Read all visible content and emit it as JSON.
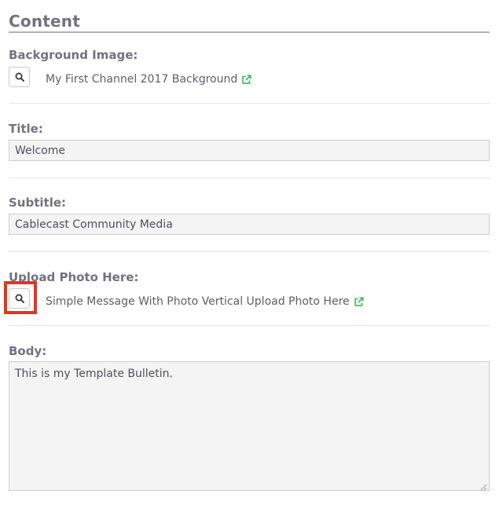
{
  "section": {
    "title": "Content"
  },
  "background_image": {
    "label": "Background Image:",
    "file_name": "My First Channel 2017 Background",
    "search_icon": "search-icon",
    "link_icon": "external-link-icon"
  },
  "title_field": {
    "label": "Title:",
    "value": "Welcome"
  },
  "subtitle_field": {
    "label": "Subtitle:",
    "value": "Cablecast Community Media"
  },
  "upload_photo": {
    "label": "Upload Photo Here:",
    "file_name": "Simple Message With Photo Vertical Upload Photo Here",
    "search_icon": "search-icon",
    "link_icon": "external-link-icon"
  },
  "body_field": {
    "label": "Body:",
    "value": "This is my Template Bulletin."
  },
  "colors": {
    "label": "#72727e",
    "link_icon": "#2fb34a",
    "highlight": "#e8341d",
    "field_bg": "#f4f4f5"
  }
}
